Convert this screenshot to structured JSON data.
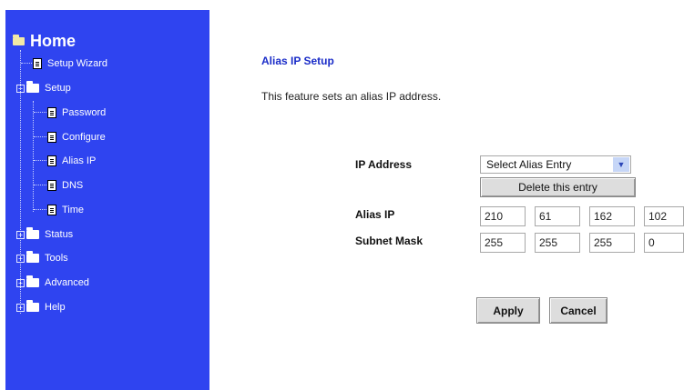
{
  "sidebar": {
    "home_label": "Home",
    "items": [
      {
        "label": "Setup Wizard",
        "type": "doc"
      },
      {
        "label": "Setup",
        "type": "folder-open"
      },
      {
        "label": "Password",
        "type": "doc"
      },
      {
        "label": "Configure",
        "type": "doc"
      },
      {
        "label": "Alias IP",
        "type": "doc"
      },
      {
        "label": "DNS",
        "type": "doc"
      },
      {
        "label": "Time",
        "type": "doc"
      },
      {
        "label": "Status",
        "type": "folder"
      },
      {
        "label": "Tools",
        "type": "folder"
      },
      {
        "label": "Advanced",
        "type": "folder"
      },
      {
        "label": "Help",
        "type": "folder"
      }
    ]
  },
  "main": {
    "title": "Alias IP Setup",
    "description": "This feature sets an alias IP address.",
    "ip_address_label": "IP Address",
    "alias_select_value": "Select Alias Entry",
    "delete_button": "Delete this entry",
    "alias_ip_label": "Alias IP",
    "alias_ip": [
      "210",
      "61",
      "162",
      "102"
    ],
    "subnet_mask_label": "Subnet Mask",
    "subnet_mask": [
      "255",
      "255",
      "255",
      "0"
    ],
    "apply_button": "Apply",
    "cancel_button": "Cancel"
  },
  "colors": {
    "sidebar_bg": "#2f44f0",
    "title_color": "#1a2cc8"
  }
}
